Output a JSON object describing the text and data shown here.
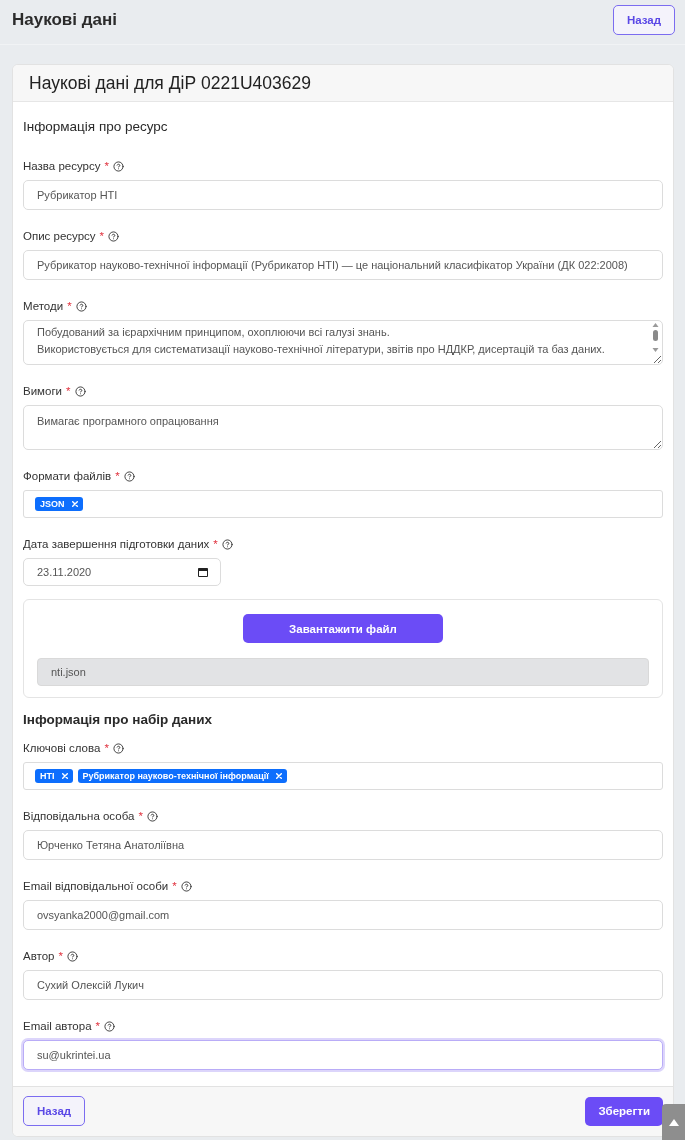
{
  "page_header": {
    "title": "Наукові дані",
    "back_button": "Назад"
  },
  "card": {
    "title": "Наукові дані для ДіР 0221U403629"
  },
  "sections": [
    {
      "heading": "Інформація про ресурс",
      "fields": [
        {
          "kind": "text",
          "label": "Назва ресурсу",
          "required_mark": "*",
          "value": "Рубрикатор НТІ",
          "focused": false
        },
        {
          "kind": "text",
          "label": "Опис ресурсу",
          "required_mark": "*",
          "value": "Рубрикатор науково-технічної інформації (Рубрикатор НТІ) — це національний класифікатор України (ДК 022:2008)",
          "focused": false
        },
        {
          "kind": "textarea",
          "label": "Методи",
          "required_mark": "*",
          "value_lines": [
            "Побудований за ієрархічним принципом, охоплюючи всі галузі знань.",
            "Використовується для систематизації науково-технічної літератури, звітів про НДДКР, дисертацій та баз даних."
          ],
          "focused": false
        },
        {
          "kind": "textarea",
          "label": "Вимоги",
          "required_mark": "*",
          "value_lines": [
            "Вимагає програмного опрацювання"
          ],
          "focused": false
        },
        {
          "kind": "tags",
          "label": "Формати файлів",
          "required_mark": "*",
          "tags": [
            "JSON"
          ],
          "focused": false
        },
        {
          "kind": "date",
          "label": "Дата завершення підготовки даних",
          "required_mark": "*",
          "value": "23.11.2020",
          "focused": false
        },
        {
          "kind": "upload",
          "button": "Завантажити файл",
          "file_name": "nti.json"
        }
      ]
    },
    {
      "heading": "Інформація про набір даних",
      "fields": [
        {
          "kind": "tags",
          "label": "Ключові слова",
          "required_mark": "*",
          "tags": [
            "НТІ",
            "Рубрикатор науково-технічної інформації"
          ],
          "focused": false
        },
        {
          "kind": "text",
          "label": "Відповідальна особа",
          "required_mark": "*",
          "value": "Юрченко Тетяна Анатоліївна",
          "focused": false
        },
        {
          "kind": "text",
          "label": "Email відповідальної особи",
          "required_mark": "*",
          "value": "ovsyanka2000@gmail.com",
          "focused": false
        },
        {
          "kind": "text",
          "label": "Автор",
          "required_mark": "*",
          "value": "Сухий Олексій Лукич",
          "focused": false
        },
        {
          "kind": "text",
          "label": "Email автора",
          "required_mark": "*",
          "value": "su@ukrintei.ua",
          "focused": true
        }
      ]
    }
  ],
  "footer": {
    "back_button": "Назад",
    "save_button": "Зберегти"
  }
}
